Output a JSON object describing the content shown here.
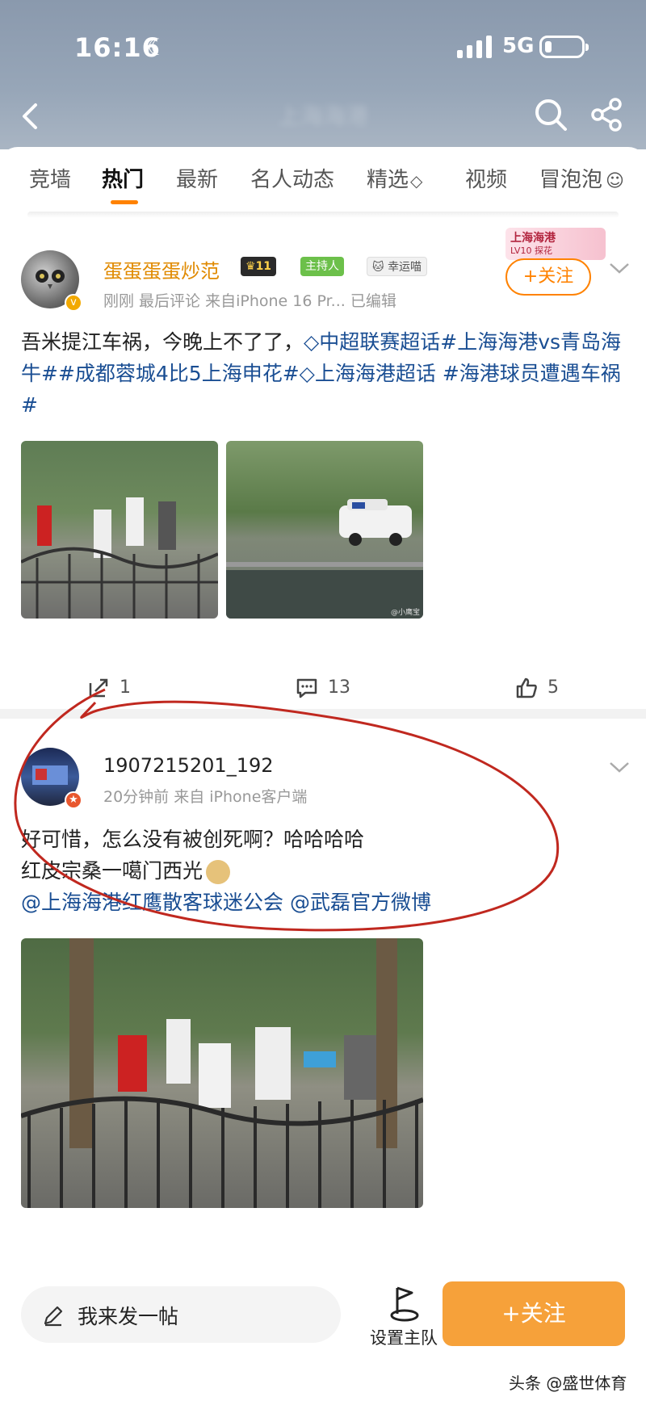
{
  "status_bar": {
    "time": "16:16",
    "network": "5G"
  },
  "nav": {
    "title": "上海海港"
  },
  "tabs": [
    {
      "label": "竞墙",
      "active": false
    },
    {
      "label": "热门",
      "active": true
    },
    {
      "label": "最新",
      "active": false
    },
    {
      "label": "名人动态",
      "active": false
    },
    {
      "label": "精选",
      "active": false
    },
    {
      "label": "视频",
      "active": false
    },
    {
      "label": "冒泡泡",
      "active": false
    }
  ],
  "post1": {
    "username": "蛋蛋蛋蛋炒范",
    "level_badge": "11",
    "host_badge": "主持人",
    "lucky_badge": "幸运喵",
    "team_tag": "上海海港",
    "team_level": "LV10 探花",
    "meta": "刚刚  最后评论  来自iPhone 16 Pr...  已编辑",
    "follow_label": "+关注",
    "text_plain1": "吾米提江车祸，今晚上不了了，",
    "text_tag1": "中超联赛超话",
    "text_tag2": "#上海海港vs青岛海牛##成都蓉城4比5上海申花#",
    "text_tag3": "上海海港超话",
    "text_tag4": "#海港球员遭遇车祸#",
    "image_credit": "@小鹰宝",
    "repost_count": "1",
    "comment_count": "13",
    "like_count": "5"
  },
  "post2": {
    "username": "1907215201_192",
    "meta": "20分钟前  来自 iPhone客户端",
    "line1": "好可惜，怎么没有被创死啊？哈哈哈哈",
    "line2": "红皮宗桑一噶门西光",
    "mention1": "@上海海港红鹰散客球迷公会",
    "mention2": "@武磊官方微博"
  },
  "bottom": {
    "compose_label": "我来发一帖",
    "set_team_label": "设置主队",
    "follow_label": "+关注"
  },
  "watermark": "头条 @盛世体育",
  "colors": {
    "accent": "#ff8200",
    "link": "#1a4e93",
    "annotation": "#c0281f"
  }
}
